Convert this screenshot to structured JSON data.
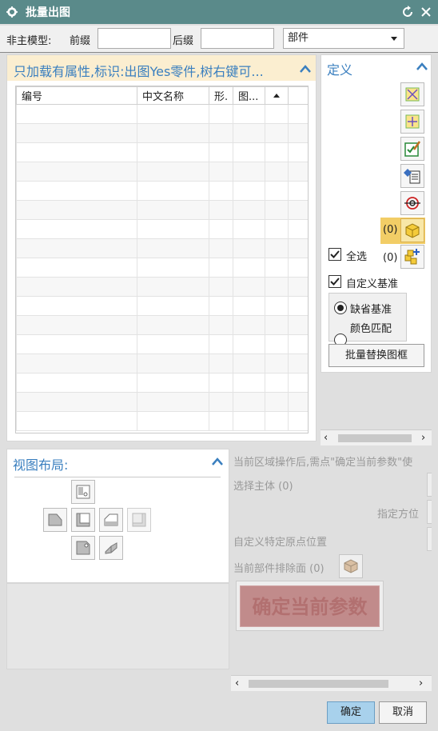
{
  "window": {
    "title": "批量出图"
  },
  "toolbar": {
    "model_label": "非主模型:",
    "prefix_label": "前缀",
    "prefix_value": "",
    "suffix_label": "后缀",
    "suffix_value": "",
    "type_select": "部件"
  },
  "list_group": {
    "title": "只加载有属性,标识:出图Yes零件,树右键可...",
    "columns": [
      "编号",
      "中文名称",
      "形.",
      "图...",
      ""
    ],
    "row_count": 17
  },
  "def_group": {
    "title": "定义",
    "count_1": "(0)",
    "count_2": "(0)",
    "select_all": "全选",
    "custom_datum": "自定义基准",
    "radio_default": "缺省基准",
    "radio_color": "颜色匹配",
    "replace_frame": "批量替换图框"
  },
  "layout_group": {
    "title": "视图布局:"
  },
  "params": {
    "hint": "当前区域操作后,需点\"确定当前参数\"使",
    "select_body": "选择主体 (0)",
    "orient": "指定方位",
    "custom_origin": "自定义特定原点位置",
    "exclude_face": "当前部件排除面 (0)",
    "confirm_params": "确定当前参数"
  },
  "footer": {
    "ok": "确定",
    "cancel": "取消"
  },
  "colors": {
    "titlebar": "#5a8a8a",
    "accent": "#3a7fbf",
    "group_bg": "#fbeed0",
    "confirm_params_bg": "#c18b8b"
  }
}
